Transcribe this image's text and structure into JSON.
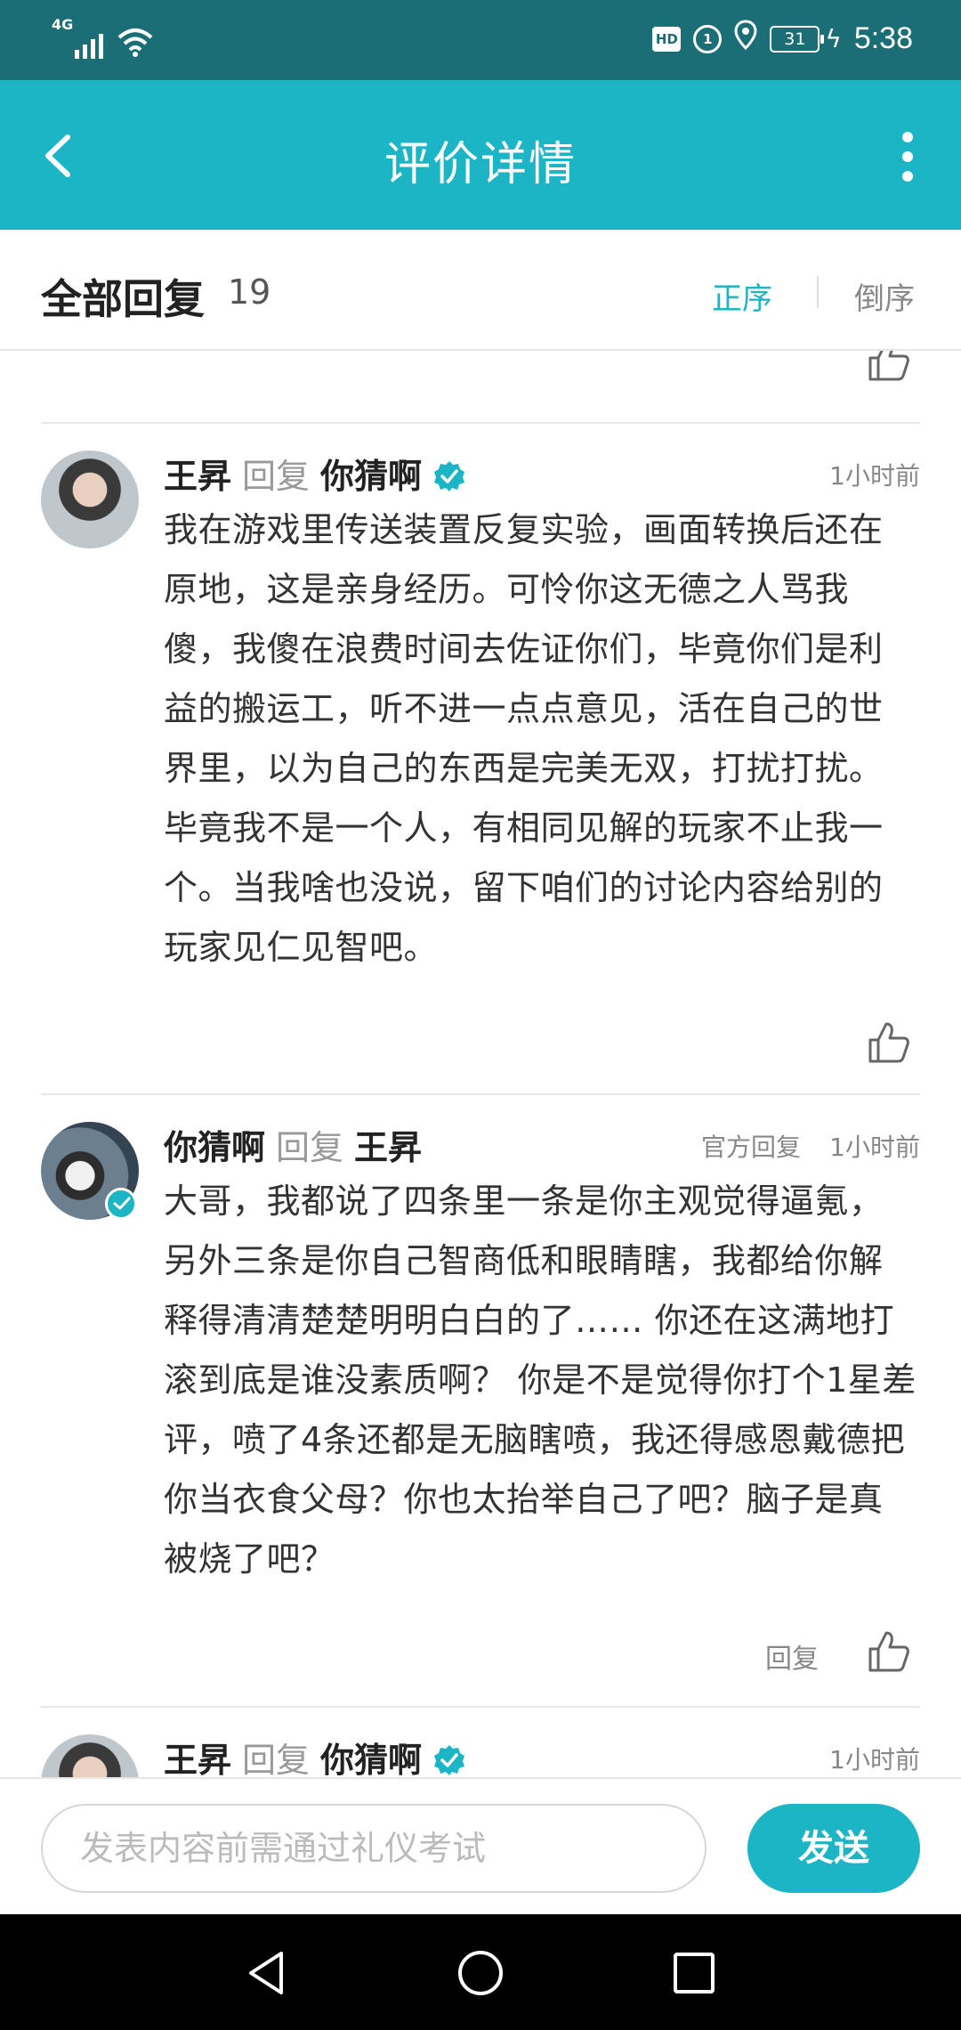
{
  "status_bar": {
    "network": "4G",
    "hd": "HD",
    "volte": "1",
    "battery": "31",
    "time": "5:38"
  },
  "header": {
    "title": "评价详情"
  },
  "sort_bar": {
    "title": "全部回复",
    "count": "19",
    "ascending": "正序",
    "descending": "倒序"
  },
  "comments": [
    {
      "author": "王昇",
      "reply_word": "回复",
      "target": "你猜啊",
      "time": "1小时前",
      "text": "我在游戏里传送装置反复实验，画面转换后还在原地，这是亲身经历。可怜你这无德之人骂我傻，我傻在浪费时间去佐证你们，毕竟你们是利益的搬运工，听不进一点点意见，活在自己的世界里，以为自己的东西是完美无双，打扰打扰。毕竟我不是一个人，有相同见解的玩家不止我一个。当我啥也没说，留下咱们的讨论内容给别的玩家见仁见智吧。"
    },
    {
      "author": "你猜啊",
      "reply_word": "回复",
      "target": "王昇",
      "official_label": "官方回复",
      "time": "1小时前",
      "text": "大哥，我都说了四条里一条是你主观觉得逼氪，另外三条是你自己智商低和眼睛瞎，我都给你解释得清清楚楚明明白白的了…… 你还在这满地打滚到底是谁没素质啊？ 你是不是觉得你打个1星差评，喷了4条还都是无脑瞎喷，我还得感恩戴德把你当衣食父母？你也太抬举自己了吧？脑子是真被烧了吧？",
      "reply_label": "回复"
    },
    {
      "author": "王昇",
      "reply_word": "回复",
      "target": "你猜啊",
      "time": "1小时前"
    }
  ],
  "input_bar": {
    "placeholder": "发表内容前需通过礼仪考试",
    "send_label": "发送"
  },
  "colors": {
    "accent": "#1bb5c6",
    "status_bar": "#1c6e76"
  }
}
